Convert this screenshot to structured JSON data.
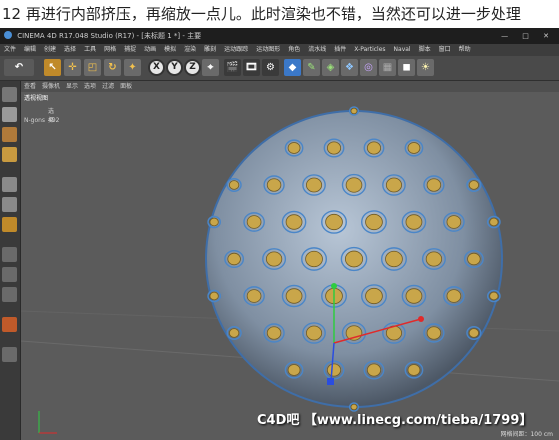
{
  "caption": "12 再进行内部挤压，再缩放一点儿。此时渲染也不错，当然还可以进一步处理",
  "window": {
    "title": "CINEMA 4D R17.048 Studio (R17) - [未标题 1 *] - 主要",
    "buttons": "— □ ✕"
  },
  "menu": [
    "文件",
    "编辑",
    "创建",
    "选择",
    "工具",
    "网格",
    "捕捉",
    "动画",
    "模拟",
    "渲染",
    "雕刻",
    "运动跟踪",
    "运动图形",
    "角色",
    "流水线",
    "插件",
    "X-Particles",
    "Naval",
    "脚本",
    "窗口",
    "帮助"
  ],
  "viewport": {
    "menu": [
      "查看",
      "摄像机",
      "显示",
      "选项",
      "过滤",
      "面板"
    ],
    "label": "透视视图",
    "stats_header": "选择",
    "stats_label": "N-gons",
    "stats_value": "492",
    "footer": "网格间距：100 cm"
  },
  "toolbar_icons": [
    "undo-icon",
    "select-icon",
    "move-icon",
    "scale-icon",
    "rotate-icon",
    "recent-tool-icon",
    "x-axis-icon",
    "y-axis-icon",
    "z-axis-icon",
    "world-coord-icon",
    "render-view-icon",
    "render-picture-icon",
    "render-settings-icon",
    "cube-icon",
    "pen-icon",
    "subdivision-icon",
    "array-icon",
    "deformer-icon",
    "floor-icon",
    "camera-icon",
    "light-icon"
  ],
  "toolbar_axes": {
    "x": "X",
    "y": "Y",
    "z": "Z"
  },
  "left_tools": [
    "make-editable-icon",
    "model-mode-icon",
    "texture-mode-icon",
    "workplane-icon",
    "points-mode-icon",
    "edges-mode-icon",
    "polygons-mode-icon",
    "enable-axis-icon",
    "snap-icon",
    "quantize-icon",
    "lock-icon",
    "soft-selection-icon"
  ],
  "watermark": "C4D吧 【www.linecg.com/tieba/1799】",
  "colors": {
    "accent": "#c08a2a",
    "mesh": "#4a86c8",
    "cap": "#c9a64a",
    "background": "#5b5b5b"
  }
}
